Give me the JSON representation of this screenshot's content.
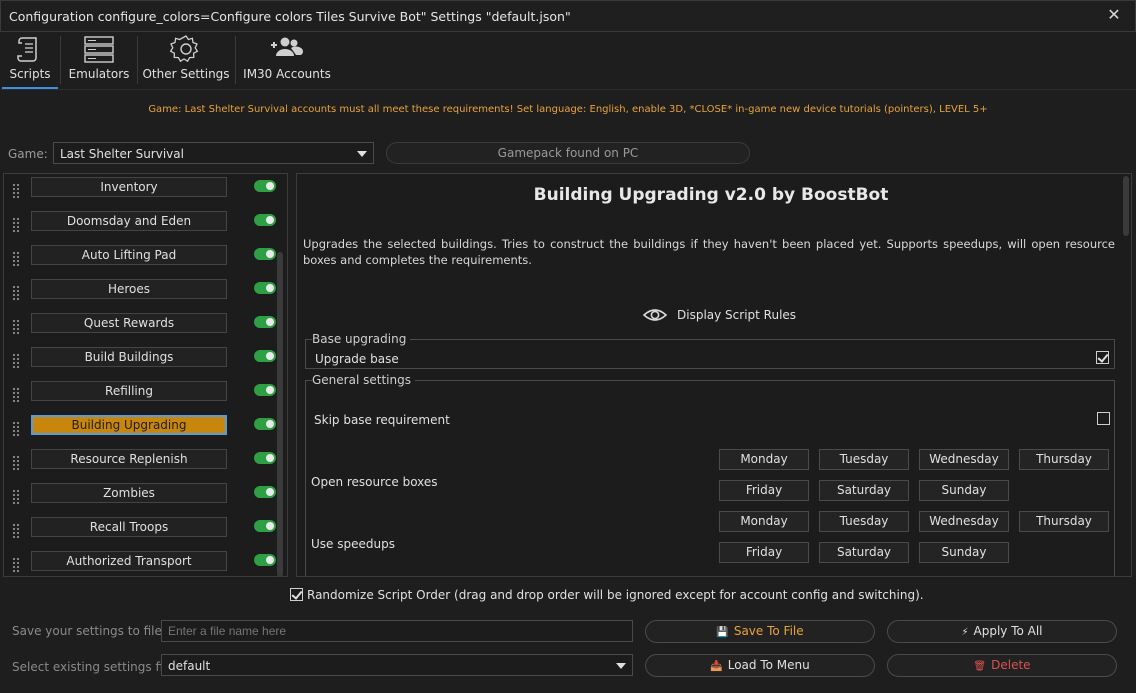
{
  "window": {
    "title": "Configuration configure_colors=Configure colors Tiles Survive Bot\" Settings \"default.json\"",
    "close_glyph": "✕"
  },
  "tabs": [
    {
      "label": "Scripts",
      "icon": "scroll-icon",
      "active": true
    },
    {
      "label": "Emulators",
      "icon": "server-icon",
      "active": false
    },
    {
      "label": "Other Settings",
      "icon": "gear-icon",
      "active": false
    },
    {
      "label": "IM30 Accounts",
      "icon": "users-add-icon",
      "active": false
    }
  ],
  "notice": "Game: Last Shelter Survival accounts must all meet these requirements! Set language: English, enable 3D, *CLOSE* in-game new device tutorials (pointers), LEVEL 5+",
  "game": {
    "label": "Game:",
    "selected": "Last Shelter Survival",
    "gamepack_status": "Gamepack found on PC"
  },
  "scripts": [
    {
      "label": "Inventory",
      "enabled": true
    },
    {
      "label": "Doomsday and Eden",
      "enabled": true
    },
    {
      "label": "Auto Lifting Pad",
      "enabled": true
    },
    {
      "label": "Heroes",
      "enabled": true
    },
    {
      "label": "Quest Rewards",
      "enabled": true
    },
    {
      "label": "Build Buildings",
      "enabled": true
    },
    {
      "label": "Refilling",
      "enabled": true
    },
    {
      "label": "Building Upgrading",
      "enabled": true,
      "active": true
    },
    {
      "label": "Resource Replenish",
      "enabled": true
    },
    {
      "label": "Zombies",
      "enabled": true
    },
    {
      "label": "Recall Troops",
      "enabled": true
    },
    {
      "label": "Authorized Transport",
      "enabled": true
    }
  ],
  "detail": {
    "title": "Building Upgrading v2.0 by BoostBot",
    "description": "Upgrades the selected buildings. Tries to construct the buildings if they haven't been placed yet. Supports speedups, will open resource boxes and completes the requirements.",
    "rules_label": "Display Script Rules",
    "base_group": {
      "legend": "Base upgrading",
      "upgrade_base_label": "Upgrade base",
      "upgrade_base_checked": true
    },
    "general_group": {
      "legend": "General settings",
      "skip_base_label": "Skip base requirement",
      "skip_base_checked": false,
      "open_boxes_label": "Open resource boxes",
      "speedups_label": "Use speedups",
      "days_row1": [
        "Monday",
        "Tuesday",
        "Wednesday",
        "Thursday"
      ],
      "days_row2": [
        "Friday",
        "Saturday",
        "Sunday"
      ]
    }
  },
  "randomize": {
    "checked": true,
    "label": "Randomize Script Order (drag and drop order will be ignored except for account config and switching)."
  },
  "bottom": {
    "save_label": "Save your settings to file",
    "save_placeholder": "Enter a file name here",
    "save_button": "Save To File",
    "apply_button": "Apply To All",
    "select_label": "Select existing settings file",
    "select_value": "default",
    "load_button": "Load To Menu",
    "delete_button": "Delete"
  },
  "colors": {
    "accent": "#3d8fe0",
    "active_script": "#c8860d",
    "notice": "#e8a33a",
    "toggle_on": "#2ea043",
    "danger": "#d9534f"
  }
}
